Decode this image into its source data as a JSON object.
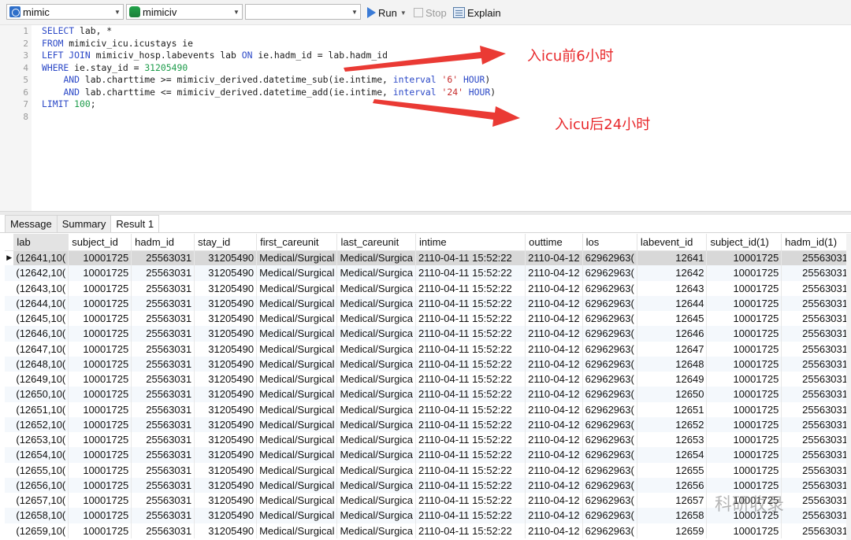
{
  "toolbar": {
    "connection": "mimic",
    "database": "mimiciv",
    "schema": "",
    "run_label": "Run",
    "stop_label": "Stop",
    "explain_label": "Explain"
  },
  "editor": {
    "line_numbers": [
      "1",
      "2",
      "3",
      "4",
      "5",
      "6",
      "7",
      "8"
    ],
    "annotation_before": "入icu前6小时",
    "annotation_after": "入icu后24小时"
  },
  "tabs": [
    "Message",
    "Summary",
    "Result 1"
  ],
  "grid": {
    "columns": [
      "lab",
      "subject_id",
      "hadm_id",
      "stay_id",
      "first_careunit",
      "last_careunit",
      "intime",
      "outtime",
      "los",
      "labevent_id",
      "subject_id(1)",
      "hadm_id(1)"
    ],
    "common": {
      "subject_id": "10001725",
      "hadm_id": "25563031",
      "stay_id": "31205490",
      "first_careunit": "Medical/Surgical",
      "last_careunit": "Medical/Surgica",
      "intime": "2110-04-11 15:52:22",
      "outtime": "2110-04-12",
      "los": ")62962963"
    },
    "labs": [
      "(12641,10(",
      "(12642,10(",
      "(12643,10(",
      "(12644,10(",
      "(12645,10(",
      "(12646,10(",
      "(12647,10(",
      "(12648,10(",
      "(12649,10(",
      "(12650,10(",
      "(12651,10(",
      "(12652,10(",
      "(12653,10(",
      "(12654,10(",
      "(12655,10(",
      "(12656,10(",
      "(12657,10(",
      "(12658,10(",
      "(12659,10("
    ],
    "labevent_ids": [
      "12641",
      "12642",
      "12643",
      "12644",
      "12645",
      "12646",
      "12647",
      "12648",
      "12649",
      "12650",
      "12651",
      "12652",
      "12653",
      "12654",
      "12655",
      "12656",
      "12657",
      "12658",
      "12659"
    ]
  },
  "watermark": "科研收录"
}
